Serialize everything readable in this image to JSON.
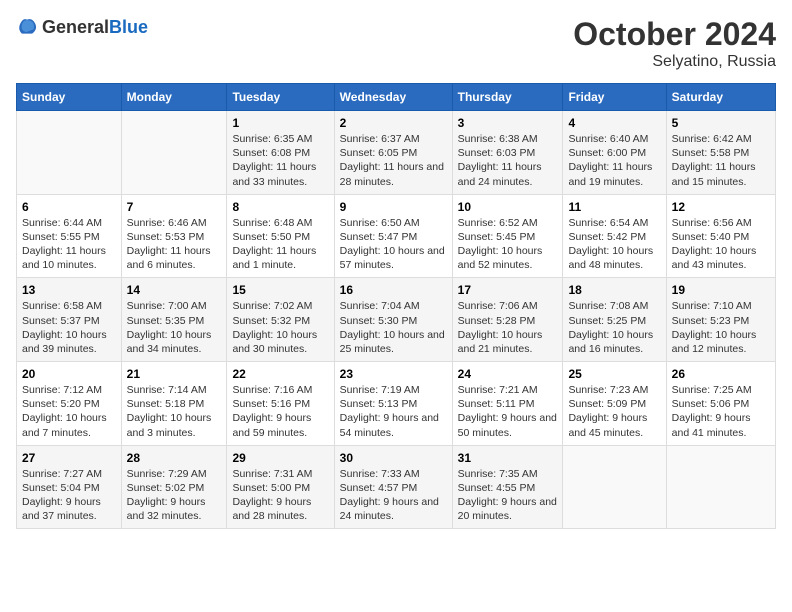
{
  "logo": {
    "general": "General",
    "blue": "Blue"
  },
  "title": "October 2024",
  "subtitle": "Selyatino, Russia",
  "days_of_week": [
    "Sunday",
    "Monday",
    "Tuesday",
    "Wednesday",
    "Thursday",
    "Friday",
    "Saturday"
  ],
  "weeks": [
    [
      {
        "day": "",
        "sunrise": "",
        "sunset": "",
        "daylight": ""
      },
      {
        "day": "",
        "sunrise": "",
        "sunset": "",
        "daylight": ""
      },
      {
        "day": "1",
        "sunrise": "Sunrise: 6:35 AM",
        "sunset": "Sunset: 6:08 PM",
        "daylight": "Daylight: 11 hours and 33 minutes."
      },
      {
        "day": "2",
        "sunrise": "Sunrise: 6:37 AM",
        "sunset": "Sunset: 6:05 PM",
        "daylight": "Daylight: 11 hours and 28 minutes."
      },
      {
        "day": "3",
        "sunrise": "Sunrise: 6:38 AM",
        "sunset": "Sunset: 6:03 PM",
        "daylight": "Daylight: 11 hours and 24 minutes."
      },
      {
        "day": "4",
        "sunrise": "Sunrise: 6:40 AM",
        "sunset": "Sunset: 6:00 PM",
        "daylight": "Daylight: 11 hours and 19 minutes."
      },
      {
        "day": "5",
        "sunrise": "Sunrise: 6:42 AM",
        "sunset": "Sunset: 5:58 PM",
        "daylight": "Daylight: 11 hours and 15 minutes."
      }
    ],
    [
      {
        "day": "6",
        "sunrise": "Sunrise: 6:44 AM",
        "sunset": "Sunset: 5:55 PM",
        "daylight": "Daylight: 11 hours and 10 minutes."
      },
      {
        "day": "7",
        "sunrise": "Sunrise: 6:46 AM",
        "sunset": "Sunset: 5:53 PM",
        "daylight": "Daylight: 11 hours and 6 minutes."
      },
      {
        "day": "8",
        "sunrise": "Sunrise: 6:48 AM",
        "sunset": "Sunset: 5:50 PM",
        "daylight": "Daylight: 11 hours and 1 minute."
      },
      {
        "day": "9",
        "sunrise": "Sunrise: 6:50 AM",
        "sunset": "Sunset: 5:47 PM",
        "daylight": "Daylight: 10 hours and 57 minutes."
      },
      {
        "day": "10",
        "sunrise": "Sunrise: 6:52 AM",
        "sunset": "Sunset: 5:45 PM",
        "daylight": "Daylight: 10 hours and 52 minutes."
      },
      {
        "day": "11",
        "sunrise": "Sunrise: 6:54 AM",
        "sunset": "Sunset: 5:42 PM",
        "daylight": "Daylight: 10 hours and 48 minutes."
      },
      {
        "day": "12",
        "sunrise": "Sunrise: 6:56 AM",
        "sunset": "Sunset: 5:40 PM",
        "daylight": "Daylight: 10 hours and 43 minutes."
      }
    ],
    [
      {
        "day": "13",
        "sunrise": "Sunrise: 6:58 AM",
        "sunset": "Sunset: 5:37 PM",
        "daylight": "Daylight: 10 hours and 39 minutes."
      },
      {
        "day": "14",
        "sunrise": "Sunrise: 7:00 AM",
        "sunset": "Sunset: 5:35 PM",
        "daylight": "Daylight: 10 hours and 34 minutes."
      },
      {
        "day": "15",
        "sunrise": "Sunrise: 7:02 AM",
        "sunset": "Sunset: 5:32 PM",
        "daylight": "Daylight: 10 hours and 30 minutes."
      },
      {
        "day": "16",
        "sunrise": "Sunrise: 7:04 AM",
        "sunset": "Sunset: 5:30 PM",
        "daylight": "Daylight: 10 hours and 25 minutes."
      },
      {
        "day": "17",
        "sunrise": "Sunrise: 7:06 AM",
        "sunset": "Sunset: 5:28 PM",
        "daylight": "Daylight: 10 hours and 21 minutes."
      },
      {
        "day": "18",
        "sunrise": "Sunrise: 7:08 AM",
        "sunset": "Sunset: 5:25 PM",
        "daylight": "Daylight: 10 hours and 16 minutes."
      },
      {
        "day": "19",
        "sunrise": "Sunrise: 7:10 AM",
        "sunset": "Sunset: 5:23 PM",
        "daylight": "Daylight: 10 hours and 12 minutes."
      }
    ],
    [
      {
        "day": "20",
        "sunrise": "Sunrise: 7:12 AM",
        "sunset": "Sunset: 5:20 PM",
        "daylight": "Daylight: 10 hours and 7 minutes."
      },
      {
        "day": "21",
        "sunrise": "Sunrise: 7:14 AM",
        "sunset": "Sunset: 5:18 PM",
        "daylight": "Daylight: 10 hours and 3 minutes."
      },
      {
        "day": "22",
        "sunrise": "Sunrise: 7:16 AM",
        "sunset": "Sunset: 5:16 PM",
        "daylight": "Daylight: 9 hours and 59 minutes."
      },
      {
        "day": "23",
        "sunrise": "Sunrise: 7:19 AM",
        "sunset": "Sunset: 5:13 PM",
        "daylight": "Daylight: 9 hours and 54 minutes."
      },
      {
        "day": "24",
        "sunrise": "Sunrise: 7:21 AM",
        "sunset": "Sunset: 5:11 PM",
        "daylight": "Daylight: 9 hours and 50 minutes."
      },
      {
        "day": "25",
        "sunrise": "Sunrise: 7:23 AM",
        "sunset": "Sunset: 5:09 PM",
        "daylight": "Daylight: 9 hours and 45 minutes."
      },
      {
        "day": "26",
        "sunrise": "Sunrise: 7:25 AM",
        "sunset": "Sunset: 5:06 PM",
        "daylight": "Daylight: 9 hours and 41 minutes."
      }
    ],
    [
      {
        "day": "27",
        "sunrise": "Sunrise: 7:27 AM",
        "sunset": "Sunset: 5:04 PM",
        "daylight": "Daylight: 9 hours and 37 minutes."
      },
      {
        "day": "28",
        "sunrise": "Sunrise: 7:29 AM",
        "sunset": "Sunset: 5:02 PM",
        "daylight": "Daylight: 9 hours and 32 minutes."
      },
      {
        "day": "29",
        "sunrise": "Sunrise: 7:31 AM",
        "sunset": "Sunset: 5:00 PM",
        "daylight": "Daylight: 9 hours and 28 minutes."
      },
      {
        "day": "30",
        "sunrise": "Sunrise: 7:33 AM",
        "sunset": "Sunset: 4:57 PM",
        "daylight": "Daylight: 9 hours and 24 minutes."
      },
      {
        "day": "31",
        "sunrise": "Sunrise: 7:35 AM",
        "sunset": "Sunset: 4:55 PM",
        "daylight": "Daylight: 9 hours and 20 minutes."
      },
      {
        "day": "",
        "sunrise": "",
        "sunset": "",
        "daylight": ""
      },
      {
        "day": "",
        "sunrise": "",
        "sunset": "",
        "daylight": ""
      }
    ]
  ]
}
